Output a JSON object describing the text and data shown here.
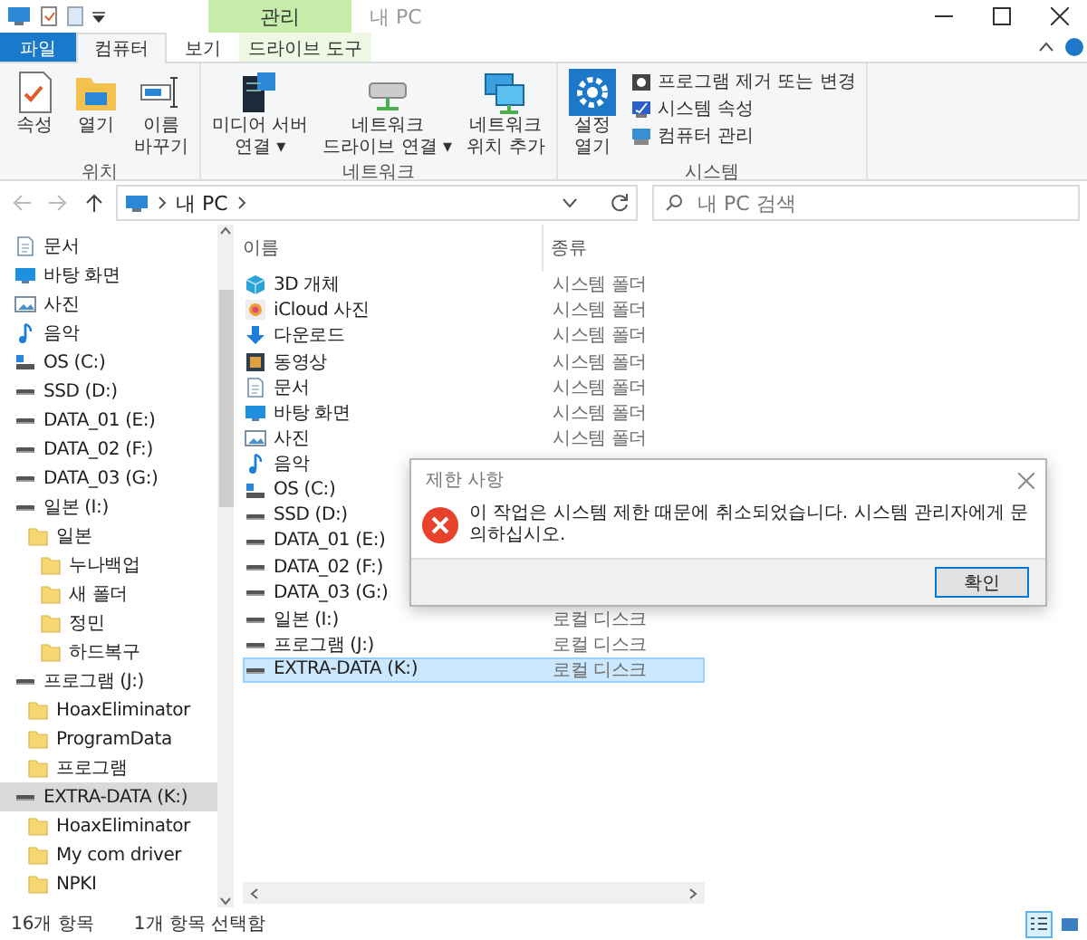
{
  "window": {
    "title": "내 PC",
    "context_tab_group": "관리"
  },
  "ribbon_tabs": [
    {
      "label": "파일",
      "kind": "file",
      "selected": false
    },
    {
      "label": "컴퓨터",
      "kind": "normal",
      "selected": true
    },
    {
      "label": "보기",
      "kind": "normal",
      "selected": false
    },
    {
      "label": "드라이브 도구",
      "kind": "context",
      "selected": false
    }
  ],
  "ribbon_groups": [
    {
      "title": "위치",
      "buttons": [
        {
          "lines": [
            "속성"
          ],
          "kind": "properties"
        },
        {
          "lines": [
            "열기"
          ],
          "kind": "open"
        },
        {
          "lines": [
            "이름",
            "바꾸기"
          ],
          "kind": "rename"
        }
      ]
    },
    {
      "title": "네트워크",
      "buttons": [
        {
          "lines": [
            "미디어 서버",
            "연결"
          ],
          "caret": "▾",
          "kind": "media"
        },
        {
          "lines": [
            "네트워크",
            "드라이브 연결"
          ],
          "caret": "▾",
          "kind": "netdrive"
        },
        {
          "lines": [
            "네트워크",
            "위치 추가"
          ],
          "kind": "netloc"
        }
      ]
    },
    {
      "title": "시스템",
      "buttons": [
        {
          "lines": [
            "설정",
            "열기"
          ],
          "kind": "settings"
        }
      ],
      "small_buttons": [
        {
          "label": "프로그램 제거 또는 변경",
          "kind": "uninstall"
        },
        {
          "label": "시스템 속성",
          "kind": "sysprops"
        },
        {
          "label": "컴퓨터 관리",
          "kind": "compmgmt"
        }
      ]
    }
  ],
  "address_bar": {
    "nav": [
      {
        "kind": "back",
        "disabled": true
      },
      {
        "kind": "forward",
        "disabled": true
      },
      {
        "kind": "up",
        "disabled": false
      }
    ],
    "path": "내 PC",
    "search_placeholder": "내 PC 검색"
  },
  "sidebar": {
    "items": [
      {
        "label": "문서",
        "kind": "documents",
        "selected": false
      },
      {
        "label": "바탕 화면",
        "kind": "desktop",
        "selected": false
      },
      {
        "label": "사진",
        "kind": "pictures",
        "selected": false
      },
      {
        "label": "음악",
        "kind": "music",
        "selected": false
      },
      {
        "label": "OS (C:)",
        "kind": "os",
        "selected": false
      },
      {
        "label": "SSD (D:)",
        "kind": "drive",
        "selected": false
      },
      {
        "label": "DATA_01 (E:)",
        "kind": "drive",
        "selected": false
      },
      {
        "label": "DATA_02 (F:)",
        "kind": "drive",
        "selected": false
      },
      {
        "label": "DATA_03 (G:)",
        "kind": "drive",
        "selected": false
      },
      {
        "label": "일본 (I:)",
        "kind": "drive",
        "selected": false,
        "children": [
          {
            "label": "일본",
            "kind": "folder",
            "selected": false,
            "children": [
              {
                "label": "누나백업",
                "kind": "folder",
                "selected": false
              },
              {
                "label": "새 폴더",
                "kind": "folder",
                "selected": false
              },
              {
                "label": "정민",
                "kind": "folder",
                "selected": false
              },
              {
                "label": "하드복구",
                "kind": "folder",
                "selected": false
              }
            ]
          }
        ]
      },
      {
        "label": "프로그램 (J:)",
        "kind": "drive",
        "selected": false,
        "children": [
          {
            "label": "HoaxEliminator",
            "kind": "folder",
            "selected": false
          },
          {
            "label": "ProgramData",
            "kind": "folder",
            "selected": false
          },
          {
            "label": "프로그램",
            "kind": "folder",
            "selected": false
          }
        ]
      },
      {
        "label": "EXTRA-DATA (K:)",
        "kind": "drive",
        "selected": true,
        "children": [
          {
            "label": "HoaxEliminator",
            "kind": "folder",
            "selected": false
          },
          {
            "label": "My com driver",
            "kind": "folder",
            "selected": false
          },
          {
            "label": "NPKI",
            "kind": "folder",
            "selected": false
          }
        ]
      }
    ]
  },
  "file_list": {
    "columns": [
      "이름",
      "종류"
    ],
    "rows": [
      {
        "name": "3D 개체",
        "type": "시스템 폴더",
        "kind": "cube",
        "selected": false
      },
      {
        "name": "iCloud 사진",
        "type": "시스템 폴더",
        "kind": "icloud",
        "selected": false
      },
      {
        "name": "다운로드",
        "type": "시스템 폴더",
        "kind": "download",
        "selected": false
      },
      {
        "name": "동영상",
        "type": "시스템 폴더",
        "kind": "video",
        "selected": false
      },
      {
        "name": "문서",
        "type": "시스템 폴더",
        "kind": "documents",
        "selected": false
      },
      {
        "name": "바탕 화면",
        "type": "시스템 폴더",
        "kind": "desktop",
        "selected": false
      },
      {
        "name": "사진",
        "type": "시스템 폴더",
        "kind": "pictures",
        "selected": false
      },
      {
        "name": "음악",
        "kind": "music",
        "selected": false
      },
      {
        "name": "OS (C:)",
        "kind": "os",
        "selected": false
      },
      {
        "name": "SSD (D:)",
        "kind": "drive",
        "selected": false
      },
      {
        "name": "DATA_01 (E:)",
        "kind": "drive",
        "selected": false
      },
      {
        "name": "DATA_02 (F:)",
        "kind": "drive",
        "selected": false
      },
      {
        "name": "DATA_03 (G:)",
        "kind": "drive",
        "selected": false
      },
      {
        "name": "일본 (I:)",
        "type": "로컬 디스크",
        "kind": "drive",
        "selected": false
      },
      {
        "name": "프로그램 (J:)",
        "type": "로컬 디스크",
        "kind": "drive",
        "selected": false
      },
      {
        "name": "EXTRA-DATA (K:)",
        "type": "로컬 디스크",
        "kind": "drive",
        "selected": true
      }
    ]
  },
  "dialog": {
    "title": "제한 사항",
    "message": "이 작업은 시스템 제한 때문에 취소되었습니다. 시스템 관리자에게 문의하십시오.",
    "button": "확인"
  },
  "status_bar": {
    "item_count": "16개 항목",
    "selection": "1개 항목 선택함",
    "views": [
      {
        "kind": "details",
        "selected": true
      },
      {
        "kind": "large-icons",
        "selected": false
      }
    ]
  }
}
